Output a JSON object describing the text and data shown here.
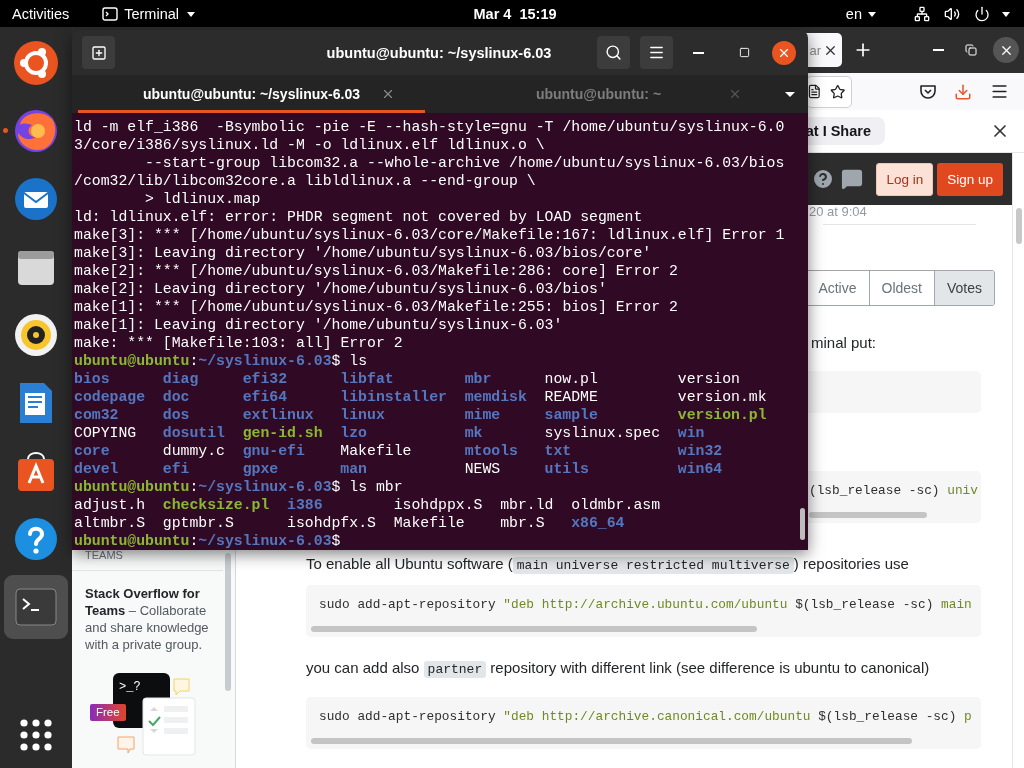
{
  "top_bar": {
    "activities": "Activities",
    "app_name": "Terminal",
    "clock": "Mar 4  15:19",
    "input_source": "en"
  },
  "dock": {
    "apps": [
      {
        "kind": "ubuntu",
        "running": false,
        "selected": false
      },
      {
        "kind": "firefox",
        "running": true,
        "selected": false
      },
      {
        "kind": "thunderbird",
        "running": false,
        "selected": false
      },
      {
        "kind": "files",
        "running": false,
        "selected": false
      },
      {
        "kind": "rhythmbox",
        "running": false,
        "selected": false
      },
      {
        "kind": "writer",
        "running": false,
        "selected": false
      },
      {
        "kind": "software",
        "running": false,
        "selected": false
      },
      {
        "kind": "help",
        "running": false,
        "selected": false
      },
      {
        "kind": "terminal",
        "running": false,
        "selected": true
      }
    ]
  },
  "browser": {
    "tab": {
      "label": "ar"
    },
    "notification": {
      "text": "at I Share"
    },
    "header": {
      "login": "Log in",
      "signup": "Sign up"
    },
    "sidebar": {
      "heading": "TEAMS",
      "promo": "**Stack Overflow for Teams** – Collaborate and share knowledge with a private group.",
      "illustration": {
        "prompt": ">_?",
        "badge": "Free"
      }
    },
    "content": {
      "timestamp": "20 at 9:04",
      "sort_tabs": [
        {
          "label": "Active",
          "selected": false
        },
        {
          "label": "Oldest",
          "selected": false
        },
        {
          "label": "Votes",
          "selected": true
        }
      ],
      "intro": "minal put:",
      "blocks": [
        {
          "kind": "code"
        },
        {
          "kind": "code_fragment",
          "segments": [
            {
              "text": "(lsb_release -sc) ",
              "kind": "plain"
            },
            {
              "text": "univ",
              "kind": "string"
            }
          ]
        },
        {
          "kind": "paragraph",
          "segments": [
            {
              "text": "To enable all Ubuntu software (",
              "kind": "text"
            },
            {
              "text": "main universe restricted multiverse",
              "kind": "code"
            },
            {
              "text": ") repositories use",
              "kind": "text"
            }
          ]
        },
        {
          "kind": "code",
          "segments": [
            {
              "text": "sudo add-apt-repository ",
              "kind": "plain"
            },
            {
              "text": "\"deb http://archive.ubuntu.com/ubuntu",
              "kind": "string"
            },
            {
              "text": " $(lsb_release -sc) ",
              "kind": "plain"
            },
            {
              "text": "main",
              "kind": "string"
            }
          ]
        },
        {
          "kind": "paragraph",
          "segments": [
            {
              "text": "you can add also ",
              "kind": "text"
            },
            {
              "text": "partner",
              "kind": "code"
            },
            {
              "text": " repository with different link (see difference is ubuntu to canonical)",
              "kind": "text"
            }
          ]
        },
        {
          "kind": "code",
          "segments": [
            {
              "text": "sudo add-apt-repository ",
              "kind": "plain"
            },
            {
              "text": "\"deb http://archive.canonical.com/ubuntu",
              "kind": "string"
            },
            {
              "text": " $(lsb_release -sc) ",
              "kind": "plain"
            },
            {
              "text": "p",
              "kind": "string"
            }
          ]
        }
      ]
    }
  },
  "terminal": {
    "title": "ubuntu@ubuntu: ~/syslinux-6.03",
    "tabs": [
      {
        "label": "ubuntu@ubuntu: ~/syslinux-6.03",
        "selected": true
      },
      {
        "label": "ubuntu@ubuntu: ~",
        "selected": false
      }
    ],
    "output": [
      {
        "kind": "line",
        "segments": [
          {
            "text": "ld -m elf_i386  -Bsymbolic -pie -E --hash-style=gnu -T /home/ubuntu/syslinux-6.0",
            "kind": "plain"
          }
        ]
      },
      {
        "kind": "line",
        "segments": [
          {
            "text": "3/core/i386/syslinux.ld -M -o ldlinux.elf ldlinux.o \\",
            "kind": "plain"
          }
        ]
      },
      {
        "kind": "line",
        "segments": [
          {
            "text": "        --start-group libcom32.a --whole-archive /home/ubuntu/syslinux-6.03/bios",
            "kind": "plain"
          }
        ]
      },
      {
        "kind": "line",
        "segments": [
          {
            "text": "/com32/lib/libcom32core.a libldlinux.a --end-group \\",
            "kind": "plain"
          }
        ]
      },
      {
        "kind": "line",
        "segments": [
          {
            "text": "        > ldlinux.map",
            "kind": "plain"
          }
        ]
      },
      {
        "kind": "line",
        "segments": [
          {
            "text": "ld: ldlinux.elf: error: PHDR segment not covered by LOAD segment",
            "kind": "plain"
          }
        ]
      },
      {
        "kind": "line",
        "segments": [
          {
            "text": "make[3]: *** [/home/ubuntu/syslinux-6.03/core/Makefile:167: ldlinux.elf] Error 1",
            "kind": "plain"
          }
        ]
      },
      {
        "kind": "line",
        "segments": [
          {
            "text": "make[3]: Leaving directory '/home/ubuntu/syslinux-6.03/bios/core'",
            "kind": "plain"
          }
        ]
      },
      {
        "kind": "line",
        "segments": [
          {
            "text": "make[2]: *** [/home/ubuntu/syslinux-6.03/Makefile:286: core] Error 2",
            "kind": "plain"
          }
        ]
      },
      {
        "kind": "line",
        "segments": [
          {
            "text": "make[2]: Leaving directory '/home/ubuntu/syslinux-6.03/bios'",
            "kind": "plain"
          }
        ]
      },
      {
        "kind": "line",
        "segments": [
          {
            "text": "make[1]: *** [/home/ubuntu/syslinux-6.03/Makefile:255: bios] Error 2",
            "kind": "plain"
          }
        ]
      },
      {
        "kind": "line",
        "segments": [
          {
            "text": "make[1]: Leaving directory '/home/ubuntu/syslinux-6.03'",
            "kind": "plain"
          }
        ]
      },
      {
        "kind": "line",
        "segments": [
          {
            "text": "make: *** [Makefile:103: all] Error 2",
            "kind": "plain"
          }
        ]
      },
      {
        "kind": "line",
        "segments": [
          {
            "text": "ubuntu@ubuntu",
            "kind": "user"
          },
          {
            "text": ":",
            "kind": "plain"
          },
          {
            "text": "~/syslinux-6.03",
            "kind": "path"
          },
          {
            "text": "$ ls",
            "kind": "plain"
          }
        ]
      },
      {
        "kind": "listing",
        "rows": [
          [
            {
              "name": "bios",
              "kind": "dir"
            },
            {
              "name": "diag",
              "kind": "dir"
            },
            {
              "name": "efi32",
              "kind": "dir"
            },
            {
              "name": "libfat",
              "kind": "dir"
            },
            {
              "name": "mbr",
              "kind": "dir"
            },
            {
              "name": "now.pl",
              "kind": "file"
            },
            {
              "name": "version",
              "kind": "file"
            }
          ],
          [
            {
              "name": "codepage",
              "kind": "dir"
            },
            {
              "name": "doc",
              "kind": "dir"
            },
            {
              "name": "efi64",
              "kind": "dir"
            },
            {
              "name": "libinstaller",
              "kind": "dir"
            },
            {
              "name": "memdisk",
              "kind": "dir"
            },
            {
              "name": "README",
              "kind": "file"
            },
            {
              "name": "version.mk",
              "kind": "file"
            }
          ],
          [
            {
              "name": "com32",
              "kind": "dir"
            },
            {
              "name": "dos",
              "kind": "dir"
            },
            {
              "name": "extlinux",
              "kind": "dir"
            },
            {
              "name": "linux",
              "kind": "dir"
            },
            {
              "name": "mime",
              "kind": "dir"
            },
            {
              "name": "sample",
              "kind": "dir"
            },
            {
              "name": "version.pl",
              "kind": "exec"
            }
          ],
          [
            {
              "name": "COPYING",
              "kind": "file"
            },
            {
              "name": "dosutil",
              "kind": "dir"
            },
            {
              "name": "gen-id.sh",
              "kind": "exec"
            },
            {
              "name": "lzo",
              "kind": "dir"
            },
            {
              "name": "mk",
              "kind": "dir"
            },
            {
              "name": "syslinux.spec",
              "kind": "file"
            },
            {
              "name": "win",
              "kind": "dir"
            }
          ],
          [
            {
              "name": "core",
              "kind": "dir"
            },
            {
              "name": "dummy.c",
              "kind": "file"
            },
            {
              "name": "gnu-efi",
              "kind": "dir"
            },
            {
              "name": "Makefile",
              "kind": "file"
            },
            {
              "name": "mtools",
              "kind": "dir"
            },
            {
              "name": "txt",
              "kind": "dir"
            },
            {
              "name": "win32",
              "kind": "dir"
            }
          ],
          [
            {
              "name": "devel",
              "kind": "dir"
            },
            {
              "name": "efi",
              "kind": "dir"
            },
            {
              "name": "gpxe",
              "kind": "dir"
            },
            {
              "name": "man",
              "kind": "dir"
            },
            {
              "name": "NEWS",
              "kind": "file"
            },
            {
              "name": "utils",
              "kind": "dir"
            },
            {
              "name": "win64",
              "kind": "dir"
            }
          ]
        ]
      },
      {
        "kind": "line",
        "segments": [
          {
            "text": "ubuntu@ubuntu",
            "kind": "user"
          },
          {
            "text": ":",
            "kind": "plain"
          },
          {
            "text": "~/syslinux-6.03",
            "kind": "path"
          },
          {
            "text": "$ ls mbr",
            "kind": "plain"
          }
        ]
      },
      {
        "kind": "listing",
        "rows": [
          [
            {
              "name": "adjust.h",
              "kind": "file"
            },
            {
              "name": "checksize.pl",
              "kind": "exec"
            },
            {
              "name": "i386",
              "kind": "dir"
            },
            {
              "name": "isohdppx.S",
              "kind": "file"
            },
            {
              "name": "mbr.ld",
              "kind": "file"
            },
            {
              "name": "oldmbr.asm",
              "kind": "file"
            }
          ],
          [
            {
              "name": "altmbr.S",
              "kind": "file"
            },
            {
              "name": "gptmbr.S",
              "kind": "file"
            },
            {
              "name": "isohdpfx.S",
              "kind": "file"
            },
            {
              "name": "Makefile",
              "kind": "file"
            },
            {
              "name": "mbr.S",
              "kind": "file"
            },
            {
              "name": "x86_64",
              "kind": "dir"
            }
          ]
        ]
      },
      {
        "kind": "line",
        "segments": [
          {
            "text": "ubuntu@ubuntu",
            "kind": "user"
          },
          {
            "text": ":",
            "kind": "plain"
          },
          {
            "text": "~/syslinux-6.03",
            "kind": "path"
          },
          {
            "text": "$",
            "kind": "plain"
          }
        ]
      }
    ]
  }
}
